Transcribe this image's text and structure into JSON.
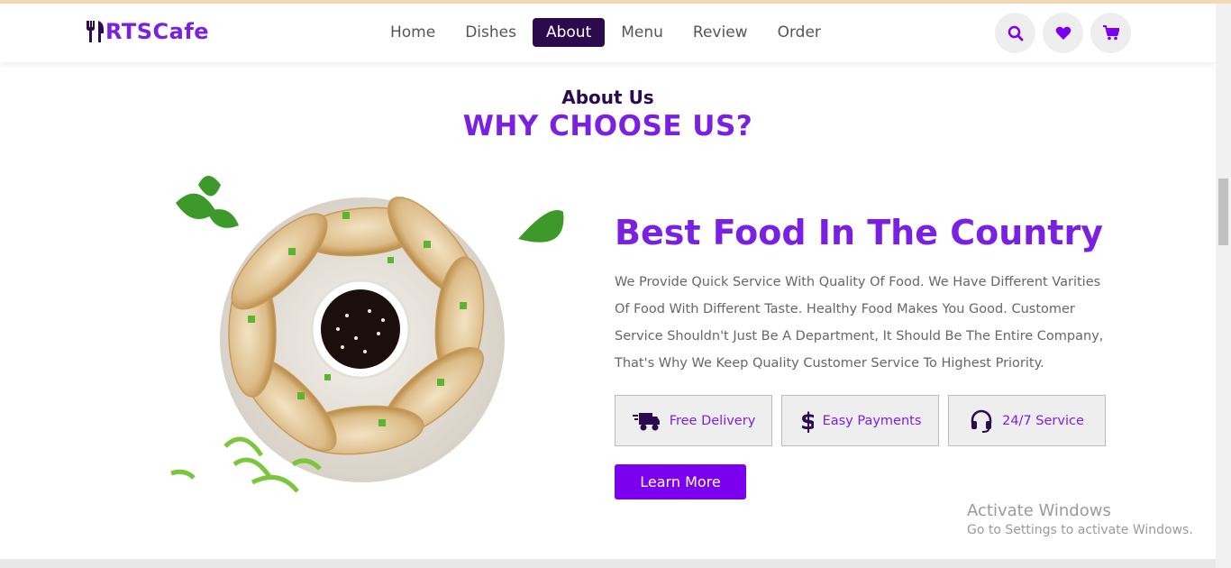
{
  "brand": {
    "name": "RTSCafe",
    "icon": "fork-knife-icon",
    "color": "#7a20e3"
  },
  "nav": {
    "items": [
      {
        "label": "Home"
      },
      {
        "label": "Dishes"
      },
      {
        "label": "About",
        "active": true
      },
      {
        "label": "Menu"
      },
      {
        "label": "Review"
      },
      {
        "label": "Order"
      }
    ]
  },
  "header_icons": [
    "search-icon",
    "heart-icon",
    "cart-icon"
  ],
  "section": {
    "subtitle": "About Us",
    "heading": "WHY CHOOSE US?"
  },
  "about": {
    "title": "Best Food In The Country",
    "description": "We Provide Quick Service With Quality Of Food. We Have Different Varities Of Food With Different Taste. Healthy Food Makes You Good. Customer Service Shouldn't Just Be A Department, It Should Be The Entire Company, That's Why We Keep Quality Customer Service To Highest Priority.",
    "features": [
      {
        "label": "Free Delivery",
        "icon": "truck-icon"
      },
      {
        "label": "Easy Payments",
        "icon": "dollar-icon"
      },
      {
        "label": "24/7 Service",
        "icon": "headset-icon"
      }
    ],
    "button_label": "Learn More"
  },
  "watermark": {
    "line1": "Activate Windows",
    "line2": "Go to Settings to activate Windows."
  },
  "colors": {
    "accent": "#7a20e3",
    "dark": "#2b0a4d",
    "button": "#7a00ee"
  }
}
